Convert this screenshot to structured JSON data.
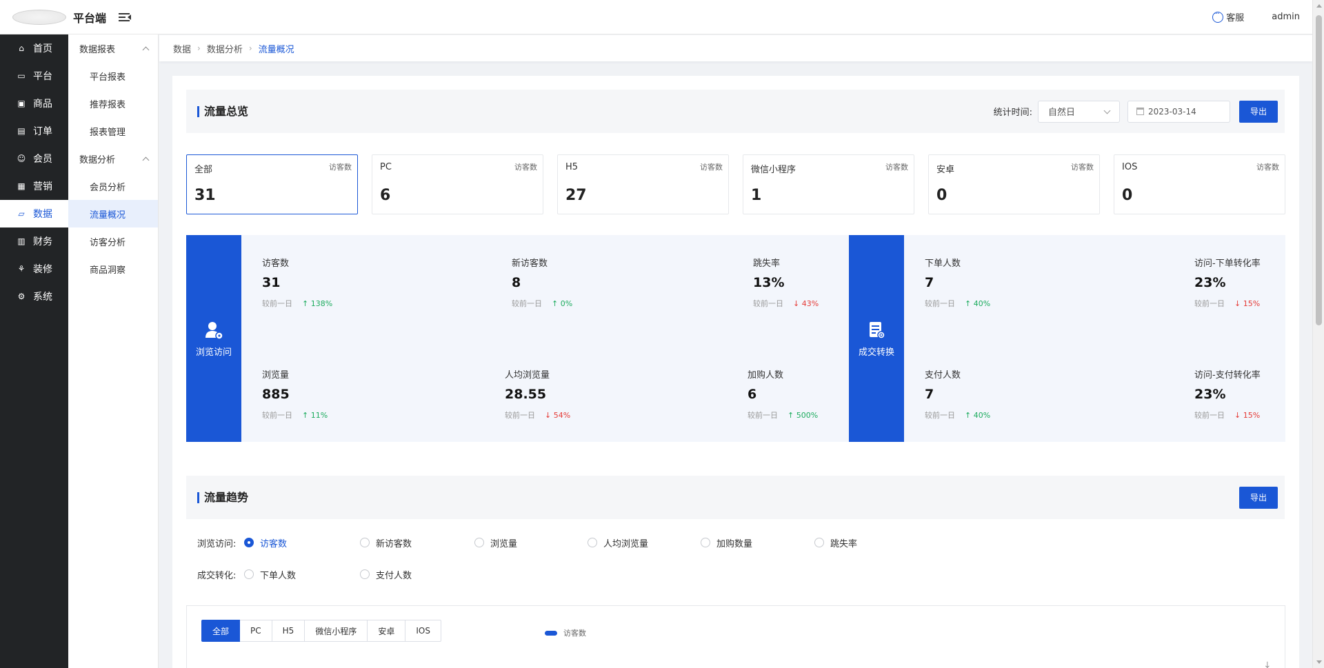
{
  "header": {
    "brand": "平台端",
    "customer_service": "客服",
    "user": "admin"
  },
  "nav": {
    "items": [
      {
        "label": "首页",
        "icon": "home-icon",
        "glyph": "⌂"
      },
      {
        "label": "平台",
        "icon": "monitor-icon",
        "glyph": "▭"
      },
      {
        "label": "商品",
        "icon": "product-icon",
        "glyph": "▣"
      },
      {
        "label": "订单",
        "icon": "order-icon",
        "glyph": "▤"
      },
      {
        "label": "会员",
        "icon": "member-icon",
        "glyph": "☺"
      },
      {
        "label": "营销",
        "icon": "gift-icon",
        "glyph": "▦"
      },
      {
        "label": "数据",
        "icon": "data-icon",
        "glyph": "▱",
        "active": true
      },
      {
        "label": "财务",
        "icon": "finance-icon",
        "glyph": "▥"
      },
      {
        "label": "装修",
        "icon": "decor-icon",
        "glyph": "⚘"
      },
      {
        "label": "系统",
        "icon": "gear-icon",
        "glyph": "⚙"
      }
    ]
  },
  "subnav": {
    "group1": "数据报表",
    "group1_items": [
      "平台报表",
      "推荐报表",
      "报表管理"
    ],
    "group2": "数据分析",
    "group2_items": [
      "会员分析",
      "流量概况",
      "访客分析",
      "商品洞察"
    ]
  },
  "breadcrumb": [
    "数据",
    "数据分析",
    "流量概况"
  ],
  "overview": {
    "title": "流量总览",
    "stat_label": "统计时间:",
    "period_select": "自然日",
    "date": "2023-03-14",
    "export": "导出"
  },
  "cards": [
    {
      "name": "全部",
      "metric": "访客数",
      "value": "31"
    },
    {
      "name": "PC",
      "metric": "访客数",
      "value": "6"
    },
    {
      "name": "H5",
      "metric": "访客数",
      "value": "27"
    },
    {
      "name": "微信小程序",
      "metric": "访客数",
      "value": "1"
    },
    {
      "name": "安卓",
      "metric": "访客数",
      "value": "0"
    },
    {
      "name": "IOS",
      "metric": "访客数",
      "value": "0"
    }
  ],
  "browse": {
    "title": "浏览访问",
    "compare_label": "较前一日",
    "metrics": [
      {
        "label": "访客数",
        "value": "31",
        "delta": "138%",
        "dir": "up"
      },
      {
        "label": "新访客数",
        "value": "8",
        "delta": "0%",
        "dir": "up"
      },
      {
        "label": "跳失率",
        "value": "13%",
        "delta": "43%",
        "dir": "down"
      },
      {
        "label": "浏览量",
        "value": "885",
        "delta": "11%",
        "dir": "up"
      },
      {
        "label": "人均浏览量",
        "value": "28.55",
        "delta": "54%",
        "dir": "down"
      },
      {
        "label": "加购人数",
        "value": "6",
        "delta": "500%",
        "dir": "up"
      }
    ]
  },
  "conversion": {
    "title": "成交转换",
    "compare_label": "较前一日",
    "metrics": [
      {
        "label": "下单人数",
        "value": "7",
        "delta": "40%",
        "dir": "up"
      },
      {
        "label": "访问-下单转化率",
        "value": "23%",
        "delta": "15%",
        "dir": "down"
      },
      {
        "label": "支付人数",
        "value": "7",
        "delta": "40%",
        "dir": "up"
      },
      {
        "label": "访问-支付转化率",
        "value": "23%",
        "delta": "15%",
        "dir": "down"
      }
    ]
  },
  "trend": {
    "title": "流量趋势",
    "export": "导出",
    "browse_label": "浏览访问:",
    "browse_options": [
      "访客数",
      "新访客数",
      "浏览量",
      "人均浏览量",
      "加购数量",
      "跳失率"
    ],
    "convert_label": "成交转化:",
    "convert_options": [
      "下单人数",
      "支付人数"
    ],
    "tabs": [
      "全部",
      "PC",
      "H5",
      "微信小程序",
      "安卓",
      "IOS"
    ],
    "legend": "访客数"
  },
  "colors": {
    "primary": "#1a57d6",
    "up": "#1bab5d",
    "down": "#e53935",
    "nav_bg": "#222426"
  }
}
